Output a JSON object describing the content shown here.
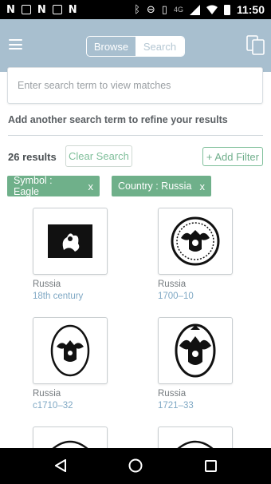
{
  "status_bar": {
    "left_icons": [
      "notification-n-icon",
      "image-icon",
      "notification-n-icon",
      "gallery-icon",
      "notification-n-icon"
    ],
    "right_icons": [
      "bluetooth-icon",
      "do-not-disturb-icon",
      "vibrate-icon",
      "signal-icon",
      "wifi-icon",
      "battery-icon"
    ],
    "network": "4G",
    "time": "11:50"
  },
  "app_bar": {
    "menu_icon": "hamburger-menu-icon",
    "tabs": [
      {
        "label": "Browse",
        "active": true
      },
      {
        "label": "Search",
        "active": false
      }
    ],
    "right_icon": "copy-icon",
    "color": "#a8bfcf"
  },
  "search": {
    "placeholder": "Enter search term to view matches",
    "value": ""
  },
  "refine_label": "Add another search term to refine your results",
  "results": {
    "count_label": "26 results",
    "clear_label": "Clear Search",
    "add_filter_label": "+ Add Filter"
  },
  "filters": [
    {
      "label": "Symbol : Eagle",
      "remove": "x"
    },
    {
      "label": "Country : Russia",
      "remove": "x"
    }
  ],
  "accent_color": "#6fb08a",
  "items": [
    {
      "country": "Russia",
      "date": "18th century",
      "thumb": "eagle-rectangular-stamp"
    },
    {
      "country": "Russia",
      "date": "1700–10",
      "thumb": "double-headed-eagle-circle"
    },
    {
      "country": "Russia",
      "date": "c1710–32",
      "thumb": "eagle-oval-shield"
    },
    {
      "country": "Russia",
      "date": "1721–33",
      "thumb": "crowned-eagle-oval"
    },
    {
      "country": "",
      "date": "",
      "thumb": "partial-stamp"
    },
    {
      "country": "",
      "date": "",
      "thumb": "partial-stamp"
    }
  ],
  "nav_bar": {
    "buttons": [
      "back-icon",
      "home-icon",
      "recents-icon"
    ]
  }
}
